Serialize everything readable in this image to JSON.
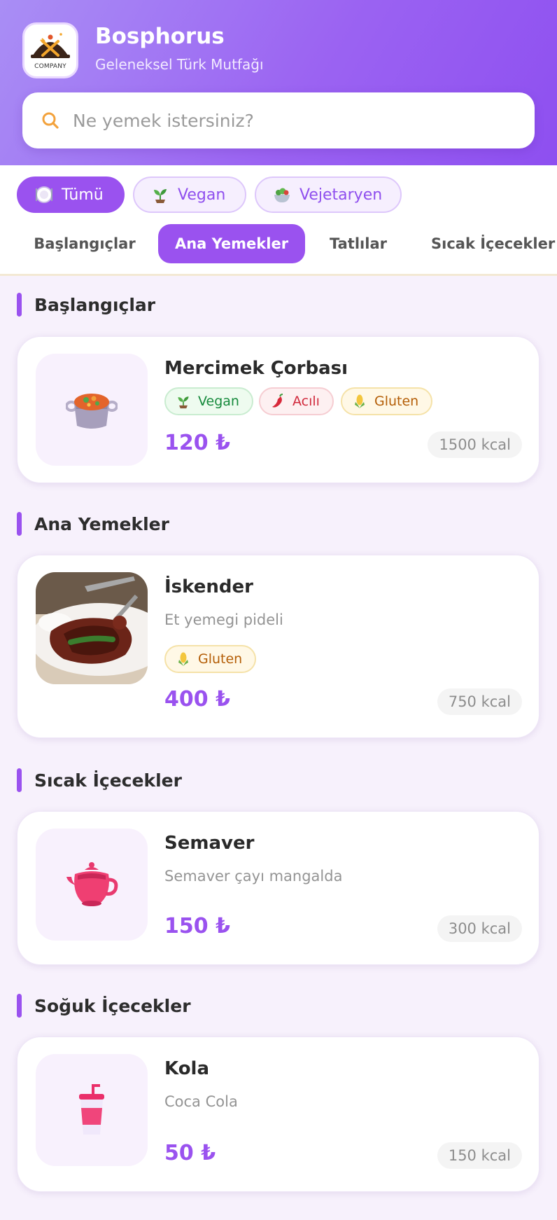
{
  "header": {
    "title": "Bosphorus",
    "subtitle": "Geleneksel Türk Mutfağı",
    "logo_caption": "COMPANY"
  },
  "search": {
    "placeholder": "Ne yemek istersiniz?",
    "value": ""
  },
  "diet_filters": [
    {
      "label": "Tümü",
      "icon": "plate-icon",
      "active": true
    },
    {
      "label": "Vegan",
      "icon": "sprout-icon",
      "active": false
    },
    {
      "label": "Vejetaryen",
      "icon": "salad-icon",
      "active": false
    }
  ],
  "categories": [
    {
      "label": "Başlangıçlar",
      "active": false
    },
    {
      "label": "Ana Yemekler",
      "active": true
    },
    {
      "label": "Tatlılar",
      "active": false
    },
    {
      "label": "Sıcak İçecekler",
      "active": false
    }
  ],
  "sections": [
    {
      "title": "Başlangıçlar",
      "items": [
        {
          "name": "Mercimek Çorbası",
          "image": "soup-pot-icon",
          "tags": [
            {
              "label": "Vegan",
              "icon": "sprout-icon"
            },
            {
              "label": "Acılı",
              "icon": "chili-icon"
            },
            {
              "label": "Gluten",
              "icon": "corn-icon"
            }
          ],
          "price": "120 ₺",
          "kcal": "1500 kcal"
        }
      ]
    },
    {
      "title": "Ana Yemekler",
      "items": [
        {
          "name": "İskender",
          "description": "Et yemegi pideli",
          "image": "iskender-photo",
          "tags": [
            {
              "label": "Gluten",
              "icon": "corn-icon"
            }
          ],
          "price": "400 ₺",
          "kcal": "750 kcal"
        }
      ]
    },
    {
      "title": "Sıcak İçecekler",
      "items": [
        {
          "name": "Semaver",
          "description": "Semaver çayı mangalda",
          "image": "teapot-icon",
          "price": "150 ₺",
          "kcal": "300 kcal"
        }
      ]
    },
    {
      "title": "Soğuk İçecekler",
      "items": [
        {
          "name": "Kola",
          "description": "Coca Cola",
          "image": "cup-with-straw-icon",
          "price": "50 ₺",
          "kcal": "150 kcal"
        }
      ]
    }
  ],
  "colors": {
    "accent": "#9a52ef",
    "header_start": "#a98ef5",
    "header_end": "#8e4ff0",
    "page_bg": "#f7f1fc"
  }
}
